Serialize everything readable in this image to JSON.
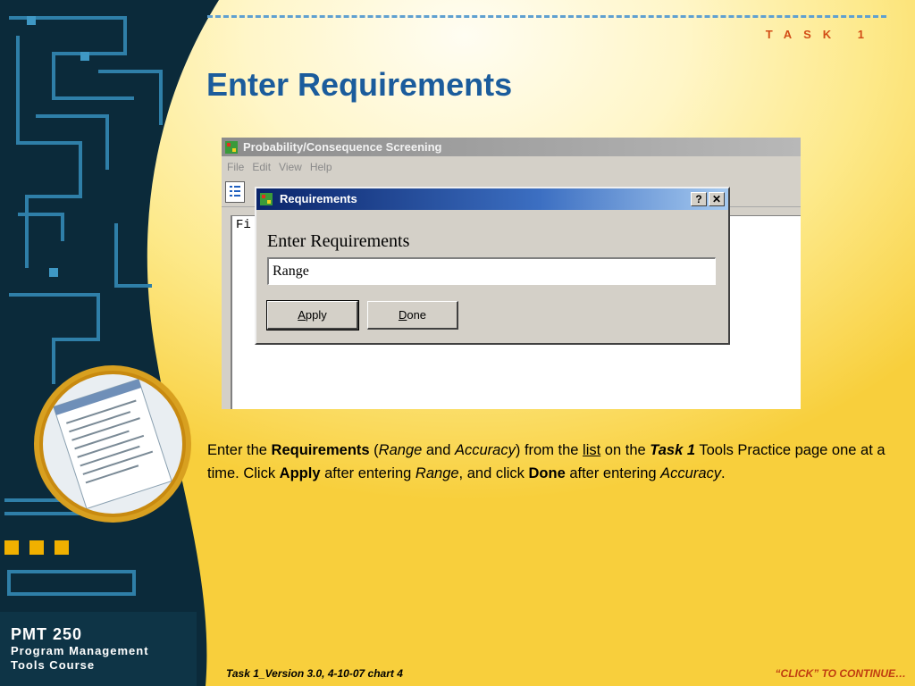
{
  "header": {
    "task_label": "TASK 1",
    "title": "Enter Requirements"
  },
  "app_window": {
    "title": "Probability/Consequence Screening",
    "menu": [
      "File",
      "Edit",
      "View",
      "Help"
    ],
    "doc_text": "Fi"
  },
  "dialog": {
    "title": "Requirements",
    "help_symbol": "?",
    "close_symbol": "✕",
    "label": "Enter Requirements",
    "input_value": "Range",
    "apply_label_first": "A",
    "apply_label_rest": "pply",
    "done_label_first": "D",
    "done_label_rest": "one"
  },
  "description": {
    "t1": "Enter the ",
    "b1": "Requirements",
    "t2": " (",
    "i1": "Range",
    "t3": " and ",
    "i2": "Accuracy",
    "t4": ") from the ",
    "link": "list",
    "t5": " on the ",
    "bi1": "Task 1",
    "t6": " Tools Practice page one at a time.  Click ",
    "b2": "Apply",
    "t7": " after entering ",
    "i3": "Range",
    "t8": ", and click ",
    "b3": "Done",
    "t9": " after entering ",
    "i4": "Accuracy",
    "t10": "."
  },
  "branding": {
    "course_code": "PMT 250",
    "line2": "Program Management",
    "line3": "Tools Course"
  },
  "footer": {
    "version": "Task 1_Version 3.0, 4-10-07    chart 4",
    "continue": "“CLICK” TO CONTINUE…"
  },
  "colors": {
    "title": "#1b5c9c",
    "accent": "#d24c16",
    "panel": "#0b2a3a",
    "circuit": "#2f7fa8"
  }
}
